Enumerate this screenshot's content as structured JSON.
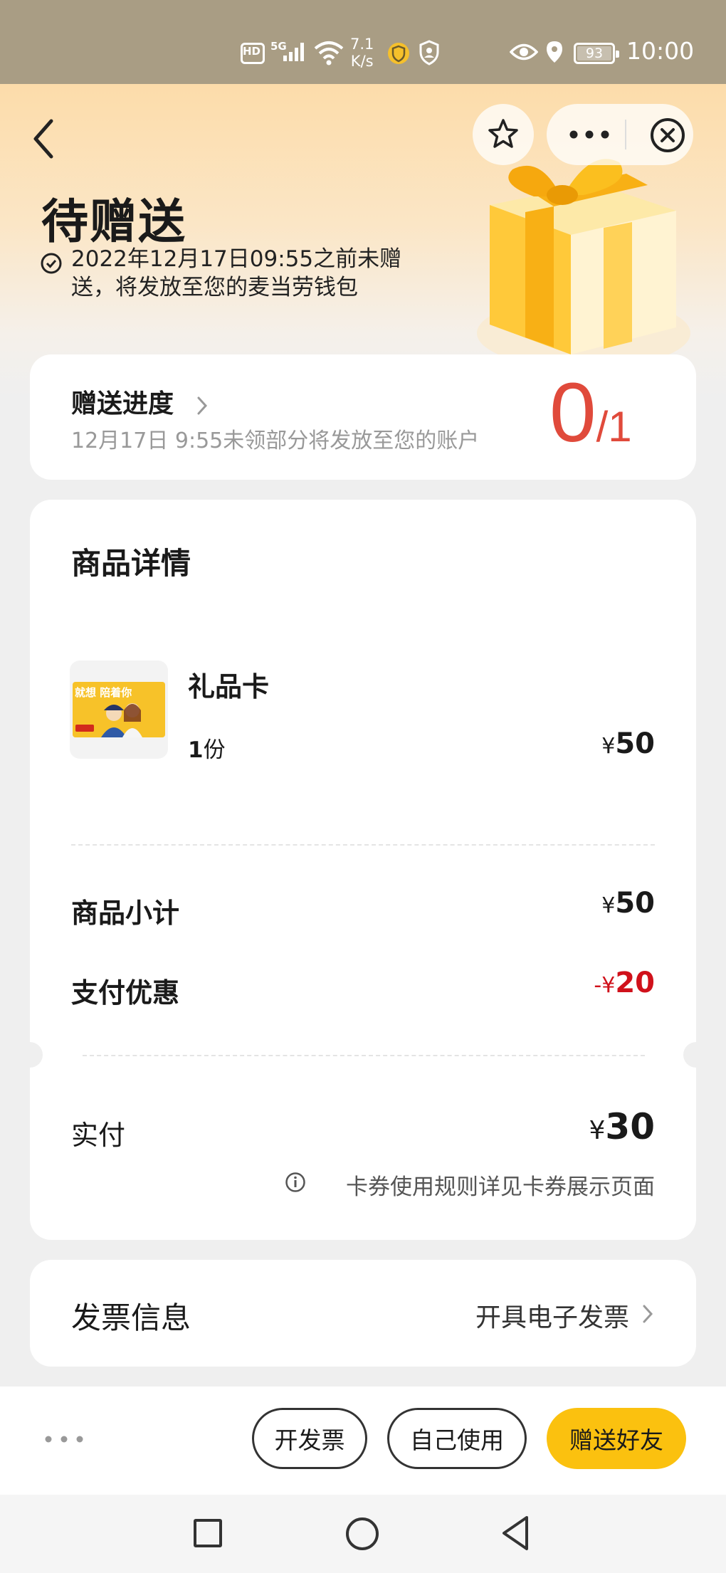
{
  "status_bar": {
    "hd": "HD",
    "network": "5G",
    "speed_value": "7.1",
    "speed_unit": "K/s",
    "battery": "93",
    "time": "10:00"
  },
  "header": {
    "title": "待赠送",
    "notice": "2022年12月17日09:55之前未赠送，将发放至您的麦当劳钱包"
  },
  "progress": {
    "title": "赠送进度",
    "subtitle": "12月17日 9:55未领部分将发放至您的账户",
    "given": "0",
    "total": "/1"
  },
  "details": {
    "title": "商品详情",
    "item": {
      "thumb_text": "就想 陪着你",
      "name": "礼品卡",
      "qty_num": "1",
      "qty_unit": "份",
      "price_symbol": "¥",
      "price": "50"
    },
    "subtotal_label": "商品小计",
    "subtotal_symbol": "¥",
    "subtotal_value": "50",
    "discount_label": "支付优惠",
    "discount_symbol": "-¥",
    "discount_value": "20",
    "paid_label": "实付",
    "paid_symbol": "¥",
    "paid_value": "30",
    "rule_note": "卡券使用规则详见卡券展示页面"
  },
  "invoice": {
    "label": "发票信息",
    "value": "开具电子发票"
  },
  "bottom_bar": {
    "invoice_button": "开发票",
    "self_use_button": "自己使用",
    "gift_button": "赠送好友"
  },
  "colors": {
    "accent_yellow": "#fbc10f",
    "progress_red": "#e04a3b",
    "discount_red": "#d0111b",
    "status_bar_bg": "#a99d84"
  },
  "icons": {
    "back": "chevron-left-icon",
    "favorite": "star-icon",
    "more": "more-dots-icon",
    "close": "close-circle-icon",
    "notice": "check-circle-icon",
    "info": "info-icon"
  }
}
